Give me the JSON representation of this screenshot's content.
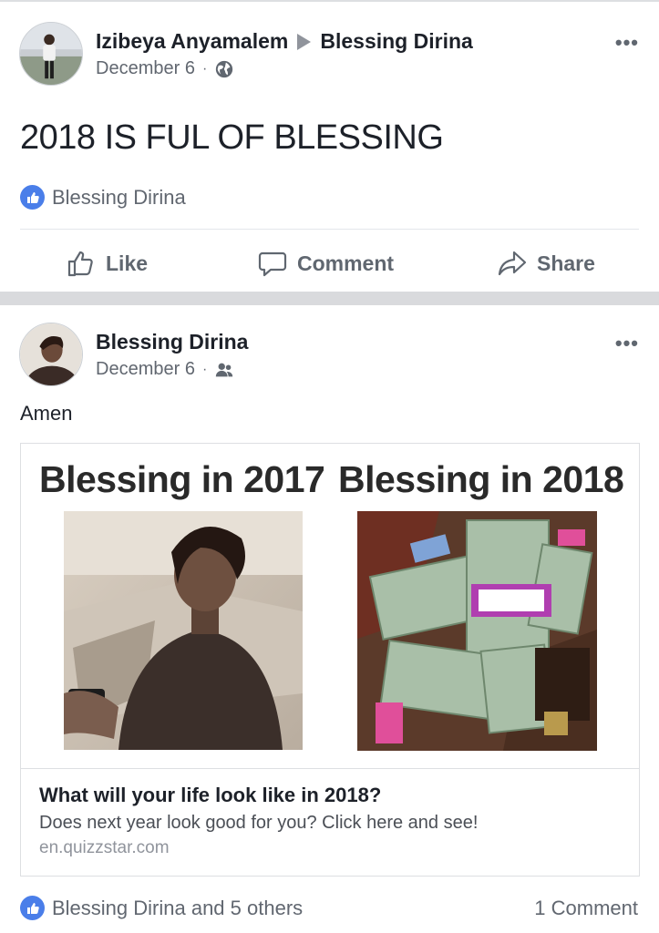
{
  "post1": {
    "author": "Izibeya Anyamalem",
    "target": "Blessing Dirina",
    "date": "December 6",
    "privacy_icon": "globe-icon",
    "text": "2018 IS FUL OF BLESSING",
    "reactions": "Blessing Dirina",
    "actions": {
      "like": "Like",
      "comment": "Comment",
      "share": "Share"
    }
  },
  "post2": {
    "author": "Blessing Dirina",
    "date": "December 6",
    "privacy_icon": "friends-icon",
    "text": "Amen",
    "link": {
      "image_heading_left": "Blessing in 2017",
      "image_heading_right": "Blessing in 2018",
      "title": "What will your life look like in 2018?",
      "description": "Does next year look good for you? Click here and see!",
      "domain": "en.quizzstar.com"
    },
    "reactions": "Blessing Dirina and 5 others",
    "comments": "1 Comment"
  },
  "colors": {
    "like_blue": "#4a7ee9",
    "divider": "#d9dadd",
    "meta_gray": "#616770"
  }
}
